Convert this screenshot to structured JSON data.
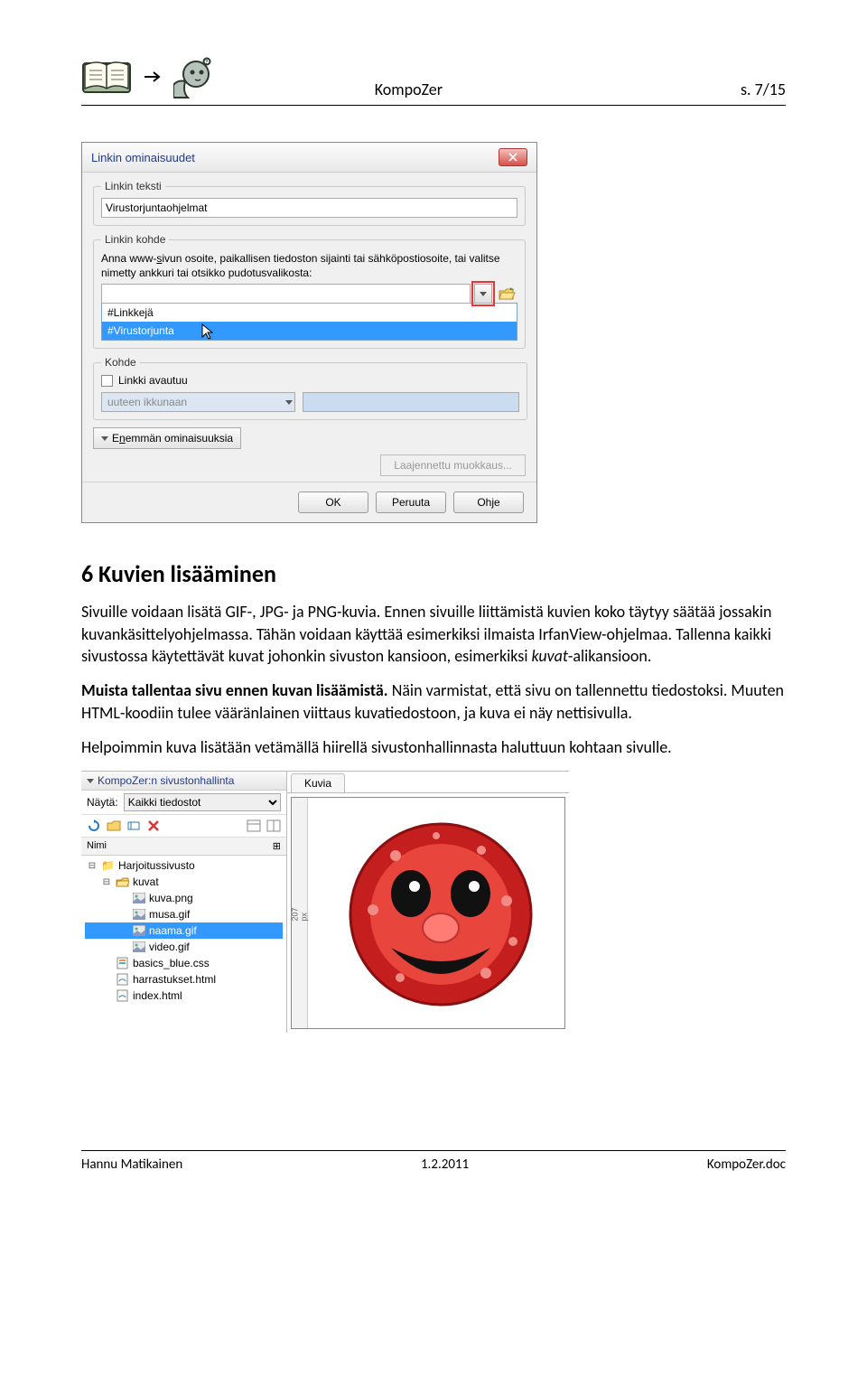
{
  "header": {
    "app": "KompoZer",
    "page": "s. 7/15"
  },
  "dialog": {
    "title": "Linkin ominaisuudet",
    "grp_text": "Linkin teksti",
    "text_value": "Virustorjuntaohjelmat",
    "grp_target": "Linkin kohde",
    "target_instr": "Anna www-sivun osoite, paikallisen tiedoston sijainti tai sähköpostiosoite, tai valitse nimetty ankkuri tai otsikko pudotusvalikosta:",
    "dd_opt1": "#Linkkejä",
    "dd_opt2": "#Virustorjunta",
    "grp_kohde": "Kohde",
    "chk_label": "Linkki avautuu",
    "sel_disabled": "uuteen ikkunaan",
    "more": "Enemmän ominaisuuksia",
    "adv_edit": "Laajennettu muokkaus...",
    "ok": "OK",
    "cancel": "Peruuta",
    "help": "Ohje"
  },
  "content": {
    "h": "6 Kuvien lisääminen",
    "p1a": "Sivuille voidaan lisätä GIF-, JPG- ja PNG-kuvia. Ennen sivuille liittämistä kuvien koko täytyy säätää jossakin kuvankäsittelyohjelmassa. Tähän voidaan käyttää esimerkiksi ilmaista IrfanView-ohjelmaa. Tallenna kaikki sivustossa käytettävät kuvat johonkin sivuston kansioon, esimerkiksi ",
    "p1b": "kuvat",
    "p1c": "-alikansioon.",
    "p2a": "Muista tallentaa sivu ennen kuvan lisäämistä.",
    "p2b": " Näin varmistat, että sivu on tallennettu tiedostoksi. Muuten HTML-koodiin tulee vääränlainen viittaus kuvatiedostoon, ja kuva ei näy nettisivulla.",
    "p3": "Helpoimmin kuva lisätään vetämällä hiirellä sivustonhallinnasta haluttuun kohtaan sivulle."
  },
  "site": {
    "panel_title": "KompoZer:n sivustonhallinta",
    "show_label": "Näytä:",
    "show_value": "Kaikki tiedostot",
    "col_name": "Nimi",
    "root": "Harjoitussivusto",
    "folder": "kuvat",
    "files": [
      "kuva.png",
      "musa.gif",
      "naama.gif",
      "video.gif"
    ],
    "f_css": "basics_blue.css",
    "f_h1": "harrastukset.html",
    "f_h2": "index.html",
    "tab": "Kuvia",
    "ruler": "207 px"
  },
  "footer": {
    "author": "Hannu Matikainen",
    "date": "1.2.2011",
    "file": "KompoZer.doc"
  }
}
